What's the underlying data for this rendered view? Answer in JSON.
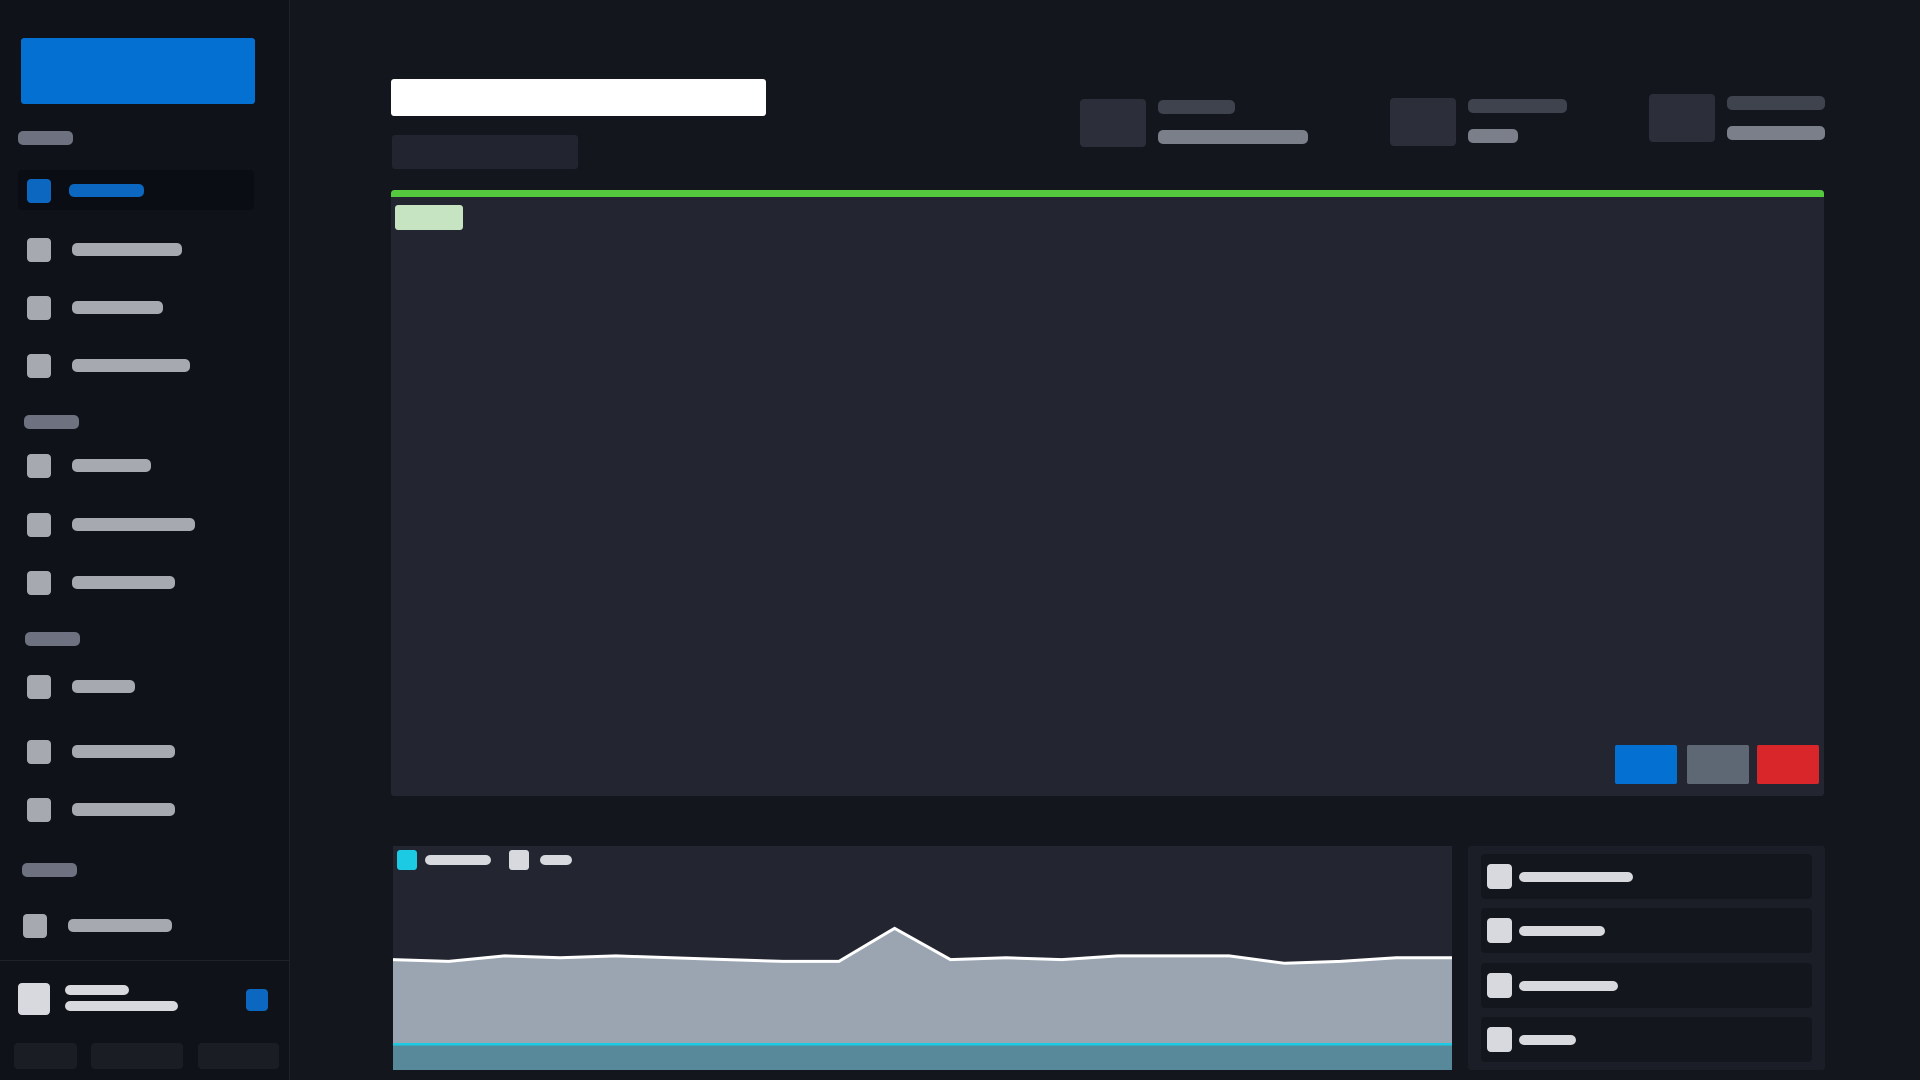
{
  "sidebar": {
    "items": [
      {
        "label": "",
        "icon": "square-icon",
        "active": true
      },
      {
        "label": "",
        "icon": "square-icon"
      },
      {
        "label": "",
        "icon": "square-icon"
      },
      {
        "label": "",
        "icon": "square-icon"
      },
      {
        "label": "",
        "icon": "square-icon"
      },
      {
        "label": "",
        "icon": "square-icon"
      },
      {
        "label": "",
        "icon": "square-icon"
      },
      {
        "label": "",
        "icon": "square-icon"
      },
      {
        "label": "",
        "icon": "square-icon"
      },
      {
        "label": "",
        "icon": "square-icon"
      },
      {
        "label": "",
        "icon": "square-icon"
      }
    ]
  },
  "header": {
    "title": "",
    "subtitle": ""
  },
  "colors": {
    "accent_blue": "#0470d1",
    "success_green": "#55c93e",
    "danger_red": "#d9262b",
    "neutral_gray": "#5e6874",
    "chart_fill": "#9aa5b1",
    "chart_line": "#ffffff",
    "chart_series2": "#1ccae3"
  },
  "viewer_buttons": [
    {
      "label": "",
      "color": "#0470d1"
    },
    {
      "label": "",
      "color": "#5e6874"
    },
    {
      "label": "",
      "color": "#d9262b"
    }
  ],
  "chart_data": {
    "type": "area",
    "x": [
      0,
      1,
      2,
      3,
      4,
      5,
      6,
      7,
      8,
      9,
      10,
      11,
      12,
      13,
      14,
      15,
      16,
      17,
      18,
      19
    ],
    "series": [
      {
        "values": [
          60,
          59,
          62,
          61,
          62,
          61,
          60,
          59,
          59,
          77,
          60,
          61,
          60,
          62,
          62,
          62,
          58,
          59,
          61,
          61
        ]
      },
      {
        "values": [
          14,
          14,
          14,
          14,
          14,
          14,
          14,
          14,
          14,
          14,
          14,
          14,
          14,
          14,
          14,
          14,
          14,
          14,
          14,
          14
        ]
      }
    ],
    "ylim": [
      0,
      100
    ],
    "legend_position": "top-left"
  }
}
